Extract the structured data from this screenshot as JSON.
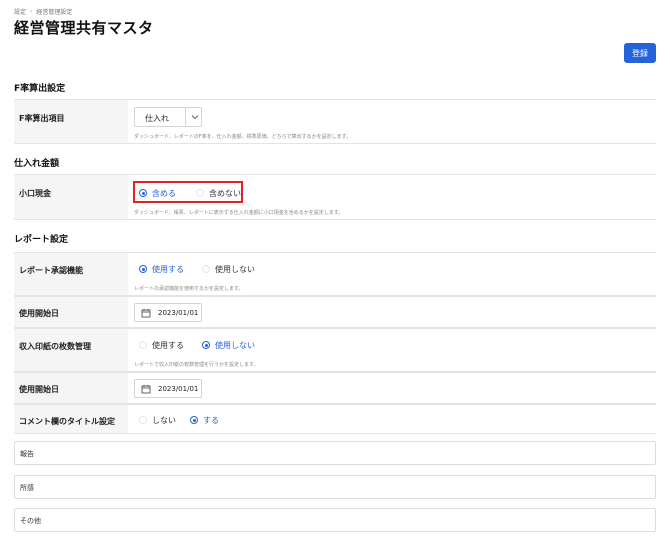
{
  "breadcrumb": {
    "items": [
      "設定",
      "経営管理設定"
    ],
    "separator": "›"
  },
  "page": {
    "title": "経営管理共有マスタ"
  },
  "toolbar": {
    "register_label": "登録"
  },
  "colors": {
    "accent": "#2563d9",
    "highlight": "#e12323"
  },
  "sections": {
    "f_rate": {
      "title": "F率算出設定",
      "item": {
        "label": "F率算出項目",
        "selected": "仕入れ",
        "help": "ダッシュボード、レポートのF率を、仕入れ金額、標準原価、どちらで算出するかを設定します。"
      }
    },
    "purchase": {
      "title": "仕入れ金額",
      "petty_cash": {
        "label": "小口現金",
        "options": [
          "含める",
          "含めない"
        ],
        "selected": "含める",
        "help": "ダッシュボード、帳票、レポートに表示する仕入れ金額に小口現金を含めるかを設定します。"
      }
    },
    "report": {
      "title": "レポート設定",
      "approval": {
        "label": "レポート承認機能",
        "options": [
          "使用する",
          "使用しない"
        ],
        "selected": "使用する",
        "help": "レポートの承認機能を使用するかを設定します。"
      },
      "approval_start": {
        "label": "使用開始日",
        "value": "2023/01/01"
      },
      "stamp": {
        "label": "収入印紙の枚数管理",
        "options": [
          "使用する",
          "使用しない"
        ],
        "selected": "使用しない",
        "help": "レポートで収入印紙の枚数管理を行うかを設定します。"
      },
      "stamp_start": {
        "label": "使用開始日",
        "value": "2023/01/01"
      },
      "comment_title": {
        "label": "コメント欄のタイトル設定",
        "options": [
          "しない",
          "する"
        ],
        "selected": "する"
      },
      "comment_titles": [
        "報告",
        "所感",
        "その他"
      ]
    }
  }
}
